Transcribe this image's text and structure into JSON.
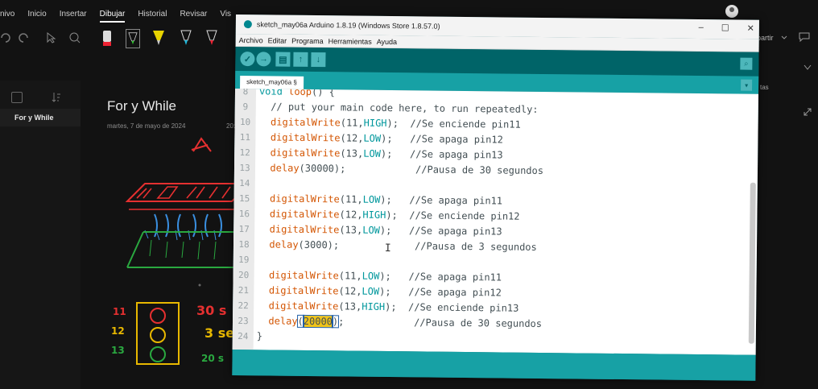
{
  "background_app": {
    "menu": [
      "nivo",
      "Inicio",
      "Insertar",
      "Dibujar",
      "Historial",
      "Revisar",
      "Vis"
    ],
    "active_menu": "Dibujar",
    "section": "For y While",
    "page_title": "For y While",
    "page_date": "martes, 7 de mayo de 2024",
    "page_time": "20:",
    "share_label": "partir",
    "side_label": "tas",
    "handwriting": {
      "pin_labels": [
        "11",
        "12",
        "13"
      ],
      "notes": [
        "30 s",
        "3 se",
        "20 s"
      ]
    }
  },
  "ide": {
    "title": "sketch_may06a Arduino 1.8.19 (Windows Store 1.8.57.0)",
    "window_controls": [
      "–",
      "☐",
      "✕"
    ],
    "menu": [
      "Archivo",
      "Editar",
      "Programa",
      "Herramientas",
      "Ayuda"
    ],
    "tab_label": "sketch_may06a §",
    "toolbar": {
      "verify": "✓",
      "upload": "→",
      "new": "▤",
      "open": "↑",
      "save": "↓",
      "serial_monitor": "⌕",
      "tab_menu": "▾"
    },
    "code": [
      {
        "n": "8",
        "parts": [
          [
            "void",
            "type"
          ],
          [
            " ",
            ""
          ],
          [
            "loop",
            "fn"
          ],
          [
            "() {",
            ""
          ]
        ]
      },
      {
        "n": "9",
        "parts": [
          [
            "  // put your main code here, to run repeatedly:",
            "cm"
          ]
        ]
      },
      {
        "n": "10",
        "parts": [
          [
            "  ",
            ""
          ],
          [
            "digitalWrite",
            "fn"
          ],
          [
            "(11,",
            ""
          ],
          [
            "HIGH",
            "const"
          ],
          [
            ");  ",
            ""
          ],
          [
            "//Se enciende pin11",
            "cm"
          ]
        ]
      },
      {
        "n": "11",
        "parts": [
          [
            "  ",
            ""
          ],
          [
            "digitalWrite",
            "fn"
          ],
          [
            "(12,",
            ""
          ],
          [
            "LOW",
            "const"
          ],
          [
            ");   ",
            ""
          ],
          [
            "//Se apaga pin12",
            "cm"
          ]
        ]
      },
      {
        "n": "12",
        "parts": [
          [
            "  ",
            ""
          ],
          [
            "digitalWrite",
            "fn"
          ],
          [
            "(13,",
            ""
          ],
          [
            "LOW",
            "const"
          ],
          [
            ");   ",
            ""
          ],
          [
            "//Se apaga pin13",
            "cm"
          ]
        ]
      },
      {
        "n": "13",
        "parts": [
          [
            "  ",
            ""
          ],
          [
            "delay",
            "fn"
          ],
          [
            "(30000);",
            ""
          ],
          [
            "            ",
            ""
          ],
          [
            "//Pausa de 30 segundos",
            "cm"
          ]
        ]
      },
      {
        "n": "14",
        "parts": [
          [
            "",
            ""
          ]
        ]
      },
      {
        "n": "15",
        "parts": [
          [
            "  ",
            ""
          ],
          [
            "digitalWrite",
            "fn"
          ],
          [
            "(11,",
            ""
          ],
          [
            "LOW",
            "const"
          ],
          [
            ");   ",
            ""
          ],
          [
            "//Se apaga pin11",
            "cm"
          ]
        ]
      },
      {
        "n": "16",
        "parts": [
          [
            "  ",
            ""
          ],
          [
            "digitalWrite",
            "fn"
          ],
          [
            "(12,",
            ""
          ],
          [
            "HIGH",
            "const"
          ],
          [
            ");  ",
            ""
          ],
          [
            "//Se enciende pin12",
            "cm"
          ]
        ]
      },
      {
        "n": "17",
        "parts": [
          [
            "  ",
            ""
          ],
          [
            "digitalWrite",
            "fn"
          ],
          [
            "(13,",
            ""
          ],
          [
            "LOW",
            "const"
          ],
          [
            ");   ",
            ""
          ],
          [
            "//Se apaga pin13",
            "cm"
          ]
        ]
      },
      {
        "n": "18",
        "parts": [
          [
            "  ",
            ""
          ],
          [
            "delay",
            "fn"
          ],
          [
            "(3000);",
            ""
          ],
          [
            "             ",
            ""
          ],
          [
            "//Pausa de 3 segundos",
            "cm"
          ]
        ]
      },
      {
        "n": "19",
        "parts": [
          [
            "",
            ""
          ]
        ]
      },
      {
        "n": "20",
        "parts": [
          [
            "  ",
            ""
          ],
          [
            "digitalWrite",
            "fn"
          ],
          [
            "(11,",
            ""
          ],
          [
            "LOW",
            "const"
          ],
          [
            ");   ",
            ""
          ],
          [
            "//Se apaga pin11",
            "cm"
          ]
        ]
      },
      {
        "n": "21",
        "parts": [
          [
            "  ",
            ""
          ],
          [
            "digitalWrite",
            "fn"
          ],
          [
            "(12,",
            ""
          ],
          [
            "LOW",
            "const"
          ],
          [
            ");   ",
            ""
          ],
          [
            "//Se apaga pin12",
            "cm"
          ]
        ]
      },
      {
        "n": "22",
        "parts": [
          [
            "  ",
            ""
          ],
          [
            "digitalWrite",
            "fn"
          ],
          [
            "(13,",
            ""
          ],
          [
            "HIGH",
            "const"
          ],
          [
            ");  ",
            ""
          ],
          [
            "//Se enciende pin13",
            "cm"
          ]
        ]
      },
      {
        "n": "23",
        "parts": [
          [
            "  ",
            ""
          ],
          [
            "delay",
            "fn"
          ],
          [
            "(",
            "bracket"
          ],
          [
            "20000",
            "hl"
          ],
          [
            ")",
            "bracket"
          ],
          [
            ";",
            ""
          ],
          [
            "            ",
            ""
          ],
          [
            "//Pausa de 30 segundos",
            "cm"
          ]
        ]
      },
      {
        "n": "24",
        "parts": [
          [
            "}",
            ""
          ]
        ]
      }
    ]
  },
  "colors": {
    "ide_teal_dark": "#006468",
    "ide_teal": "#17a1a5",
    "keyword_orange": "#d35400",
    "constant_teal": "#00979c",
    "selection_yellow": "#f0c419"
  }
}
